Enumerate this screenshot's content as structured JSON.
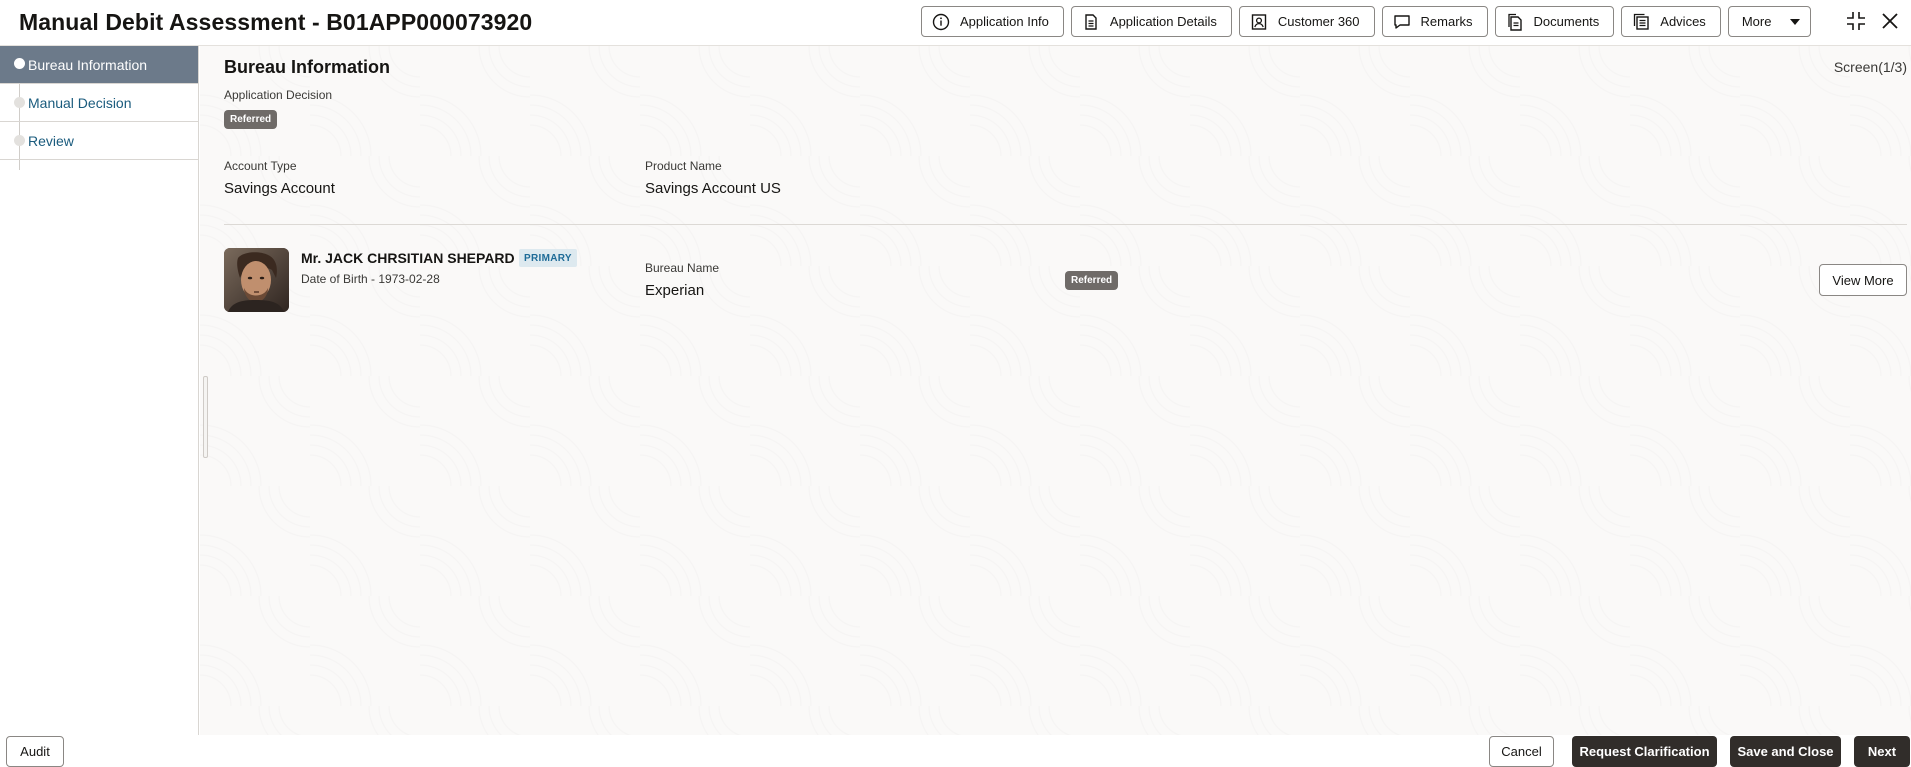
{
  "header": {
    "title": "Manual Debit Assessment - B01APP000073920",
    "toolbar": [
      {
        "label": "Application Info",
        "icon": "info-icon"
      },
      {
        "label": "Application Details",
        "icon": "document-icon"
      },
      {
        "label": "Customer 360",
        "icon": "user-card-icon"
      },
      {
        "label": "Remarks",
        "icon": "comment-icon"
      },
      {
        "label": "Documents",
        "icon": "documents-icon"
      },
      {
        "label": "Advices",
        "icon": "advices-icon"
      }
    ],
    "more_label": "More"
  },
  "sidebar": {
    "items": [
      {
        "label": "Bureau Information",
        "active": true
      },
      {
        "label": "Manual Decision",
        "active": false
      },
      {
        "label": "Review",
        "active": false
      }
    ]
  },
  "main": {
    "section_title": "Bureau Information",
    "screen_indicator": "Screen(1/3)",
    "application_decision_label": "Application Decision",
    "application_decision_value": "Referred",
    "account_type_label": "Account Type",
    "account_type_value": "Savings Account",
    "product_name_label": "Product Name",
    "product_name_value": "Savings Account US",
    "applicant": {
      "name": "Mr. JACK CHRSITIAN SHEPARD",
      "tag": "PRIMARY",
      "dob": "Date of Birth - 1973-02-28",
      "bureau_name_label": "Bureau Name",
      "bureau_name_value": "Experian",
      "status": "Referred",
      "view_more_label": "View More"
    }
  },
  "footer": {
    "audit_label": "Audit",
    "cancel_label": "Cancel",
    "request_clarification_label": "Request Clarification",
    "save_close_label": "Save and Close",
    "next_label": "Next"
  },
  "colors": {
    "active_nav_bg": "#6c7a8a",
    "badge_bg": "#6f6b68",
    "primary_tag_bg": "#dde9ef",
    "primary_tag_text": "#1e6b97",
    "dark_button_bg": "#312d2a",
    "nav_link": "#1a5b7d"
  }
}
